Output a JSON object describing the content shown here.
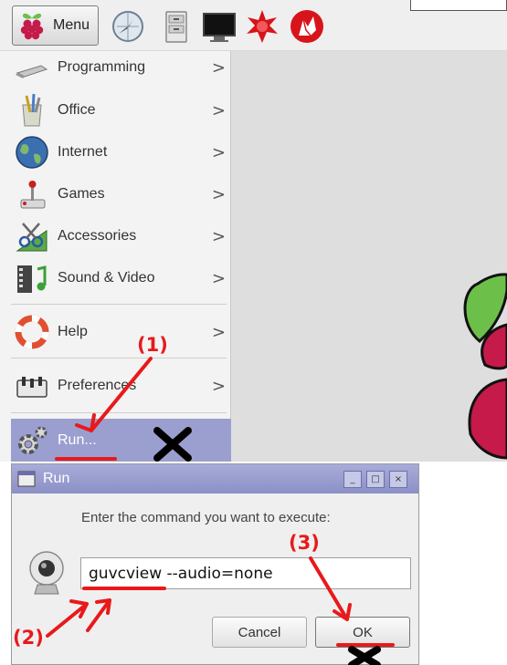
{
  "taskbar": {
    "menu_label": "Menu",
    "launchers": [
      "web-browser-icon",
      "file-manager-icon",
      "terminal-icon",
      "mathematica-icon",
      "wolfram-icon"
    ]
  },
  "menu": {
    "items": [
      {
        "label": "Programming",
        "icon": "programming-icon",
        "submenu": ">"
      },
      {
        "label": "Office",
        "icon": "office-icon",
        "submenu": ">"
      },
      {
        "label": "Internet",
        "icon": "internet-icon",
        "submenu": ">"
      },
      {
        "label": "Games",
        "icon": "games-icon",
        "submenu": ">"
      },
      {
        "label": "Accessories",
        "icon": "accessories-icon",
        "submenu": ">"
      },
      {
        "label": "Sound & Video",
        "icon": "sound-video-icon",
        "submenu": ">"
      },
      {
        "label": "Help",
        "icon": "help-icon",
        "submenu": ">"
      },
      {
        "label": "Preferences",
        "icon": "preferences-icon",
        "submenu": ">"
      }
    ],
    "run": {
      "label": "Run...",
      "icon": "gear-icon"
    }
  },
  "dialog": {
    "title": "Run",
    "prompt": "Enter the command you want to execute:",
    "command": "guvcview --audio=none",
    "cancel_label": "Cancel",
    "ok_label": "OK",
    "window_buttons": [
      "_",
      "□",
      "×"
    ]
  },
  "annotations": {
    "step1": "(1)",
    "step2": "(2)",
    "step3": "(3)"
  },
  "colors": {
    "highlight": "#9b9fcf",
    "annotation": "#e8191b",
    "raspberry": "#c51a4a",
    "leaf": "#6cc04a"
  }
}
